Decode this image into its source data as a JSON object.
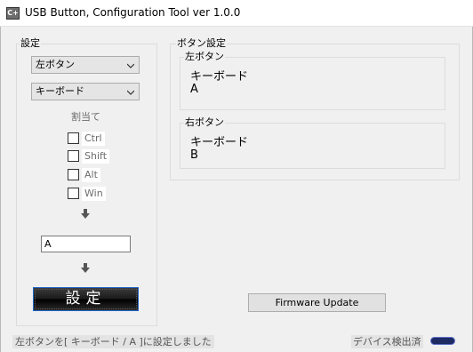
{
  "window": {
    "title": "USB Button, Configuration Tool ver 1.0.0",
    "icon": "app-icon",
    "icon_text": "C+"
  },
  "settings_group": {
    "label": "設定",
    "button_select": "左ボタン",
    "type_select": "キーボード",
    "assign_label": "割当て",
    "modifiers": [
      {
        "label": "Ctrl",
        "checked": false
      },
      {
        "label": "Shift",
        "checked": false
      },
      {
        "label": "Alt",
        "checked": false
      },
      {
        "label": "Win",
        "checked": false
      }
    ],
    "key_value": "A",
    "set_button_label": "設定"
  },
  "button_config_group": {
    "label": "ボタン設定",
    "left": {
      "label": "左ボタン",
      "type": "キーボード",
      "key": "A"
    },
    "right": {
      "label": "右ボタン",
      "type": "キーボード",
      "key": "B"
    }
  },
  "firmware_button_label": "Firmware Update",
  "status": {
    "message": "左ボタンを[ キーボード / A ]に設定しました",
    "device": "デバイス検出済"
  },
  "colors": {
    "set_button_bg": "#1a1a1a",
    "set_button_border": "#1e66c8",
    "usb_icon": "#1d2a63"
  }
}
